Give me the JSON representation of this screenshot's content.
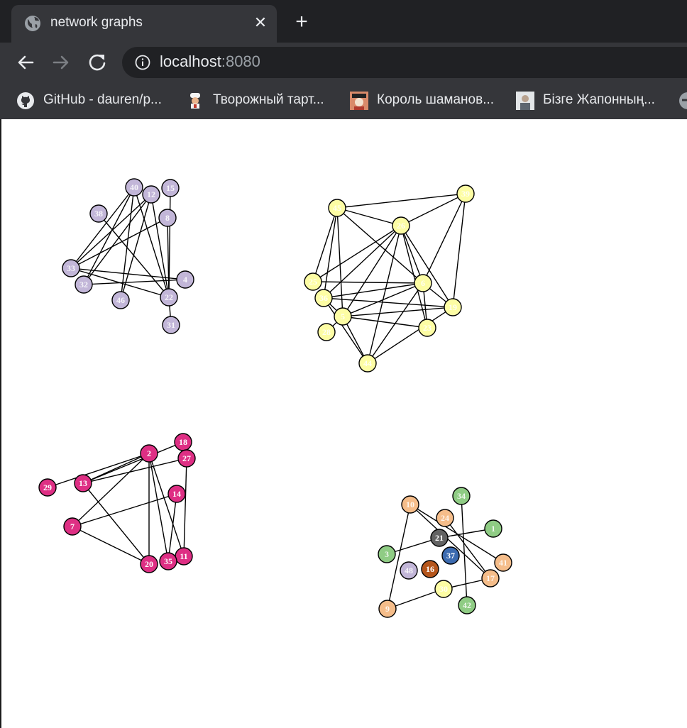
{
  "browser": {
    "tab_title": "network graphs",
    "tab_close_glyph": "✕",
    "new_tab_glyph": "+",
    "url_host": "localhost",
    "url_port": ":8080",
    "icons": {
      "tab": "globe-icon",
      "back": "back-arrow-icon",
      "forward": "forward-arrow-icon",
      "reload": "reload-icon",
      "info": "info-icon"
    },
    "bookmarks": [
      {
        "label": "GitHub - dauren/p...",
        "icon": "github-icon"
      },
      {
        "label": "Творожный тарт...",
        "icon": "chef-favicon"
      },
      {
        "label": "Король шаманов...",
        "icon": "pirate-favicon"
      },
      {
        "label": "Бізге Жапонның...",
        "icon": "portrait-favicon"
      }
    ]
  },
  "colors": {
    "purple": "#c2b6d8",
    "yellow": "#fdfda4",
    "pink": "#de2f84",
    "orange": "#f5bd8a",
    "green": "#8fcc84",
    "darkgray": "#636363",
    "blue": "#3c6bb0",
    "brown": "#b5561c"
  },
  "graphs": [
    {
      "name": "purple-cluster",
      "color": "purple",
      "nodes": [
        "40",
        "12",
        "15",
        "38",
        "8",
        "33",
        "32",
        "4",
        "46",
        "22",
        "31"
      ],
      "edges": [
        [
          "40",
          "33"
        ],
        [
          "40",
          "32"
        ],
        [
          "40",
          "46"
        ],
        [
          "40",
          "22"
        ],
        [
          "12",
          "33"
        ],
        [
          "12",
          "32"
        ],
        [
          "12",
          "22"
        ],
        [
          "12",
          "46"
        ],
        [
          "15",
          "22"
        ],
        [
          "38",
          "22"
        ],
        [
          "8",
          "33"
        ],
        [
          "8",
          "22"
        ],
        [
          "33",
          "4"
        ],
        [
          "33",
          "22"
        ],
        [
          "32",
          "4"
        ],
        [
          "22",
          "31"
        ]
      ]
    },
    {
      "name": "yellow-cluster",
      "color": "yellow",
      "nodes": [
        "45",
        "39",
        "26",
        "25",
        "6",
        "36",
        "19",
        "5",
        "28",
        "23",
        "44"
      ],
      "edges": [
        [
          "45",
          "39"
        ],
        [
          "45",
          "26"
        ],
        [
          "45",
          "25"
        ],
        [
          "45",
          "36"
        ],
        [
          "45",
          "6"
        ],
        [
          "45",
          "5"
        ],
        [
          "39",
          "26"
        ],
        [
          "39",
          "6"
        ],
        [
          "39",
          "19"
        ],
        [
          "26",
          "25"
        ],
        [
          "26",
          "36"
        ],
        [
          "26",
          "6"
        ],
        [
          "26",
          "19"
        ],
        [
          "26",
          "5"
        ],
        [
          "26",
          "23"
        ],
        [
          "26",
          "44"
        ],
        [
          "25",
          "6"
        ],
        [
          "36",
          "6"
        ],
        [
          "36",
          "19"
        ],
        [
          "36",
          "5"
        ],
        [
          "6",
          "5"
        ],
        [
          "6",
          "19"
        ],
        [
          "6",
          "44"
        ],
        [
          "6",
          "23"
        ],
        [
          "19",
          "5"
        ],
        [
          "19",
          "44"
        ],
        [
          "5",
          "28"
        ],
        [
          "5",
          "23"
        ],
        [
          "5",
          "44"
        ],
        [
          "36",
          "44"
        ]
      ]
    },
    {
      "name": "pink-cluster",
      "color": "pink",
      "nodes": [
        "18",
        "2",
        "27",
        "29",
        "13",
        "14",
        "7",
        "11",
        "35",
        "20"
      ],
      "edges": [
        [
          "2",
          "29"
        ],
        [
          "2",
          "13"
        ],
        [
          "2",
          "7"
        ],
        [
          "2",
          "20"
        ],
        [
          "2",
          "35"
        ],
        [
          "2",
          "11"
        ],
        [
          "18",
          "13"
        ],
        [
          "27",
          "13"
        ],
        [
          "27",
          "11"
        ],
        [
          "13",
          "20"
        ],
        [
          "14",
          "7"
        ],
        [
          "14",
          "35"
        ],
        [
          "7",
          "20"
        ]
      ]
    },
    {
      "name": "mixed-cluster",
      "color": "orange",
      "nodes": [
        {
          "id": "34",
          "color": "green"
        },
        {
          "id": "10",
          "color": "orange"
        },
        {
          "id": "24",
          "color": "orange"
        },
        {
          "id": "1",
          "color": "green"
        },
        {
          "id": "21",
          "color": "darkgray"
        },
        {
          "id": "3",
          "color": "green"
        },
        {
          "id": "37",
          "color": "blue"
        },
        {
          "id": "41",
          "color": "orange"
        },
        {
          "id": "48",
          "color": "purple"
        },
        {
          "id": "16",
          "color": "brown"
        },
        {
          "id": "17",
          "color": "orange"
        },
        {
          "id": "30",
          "color": "yellow"
        },
        {
          "id": "42",
          "color": "green"
        },
        {
          "id": "9",
          "color": "orange"
        }
      ],
      "edges": [
        [
          "10",
          "9"
        ],
        [
          "10",
          "41"
        ],
        [
          "10",
          "17"
        ],
        [
          "24",
          "17"
        ],
        [
          "34",
          "42"
        ],
        [
          "21",
          "1"
        ],
        [
          "21",
          "3"
        ],
        [
          "30",
          "9"
        ],
        [
          "30",
          "17"
        ]
      ]
    }
  ]
}
